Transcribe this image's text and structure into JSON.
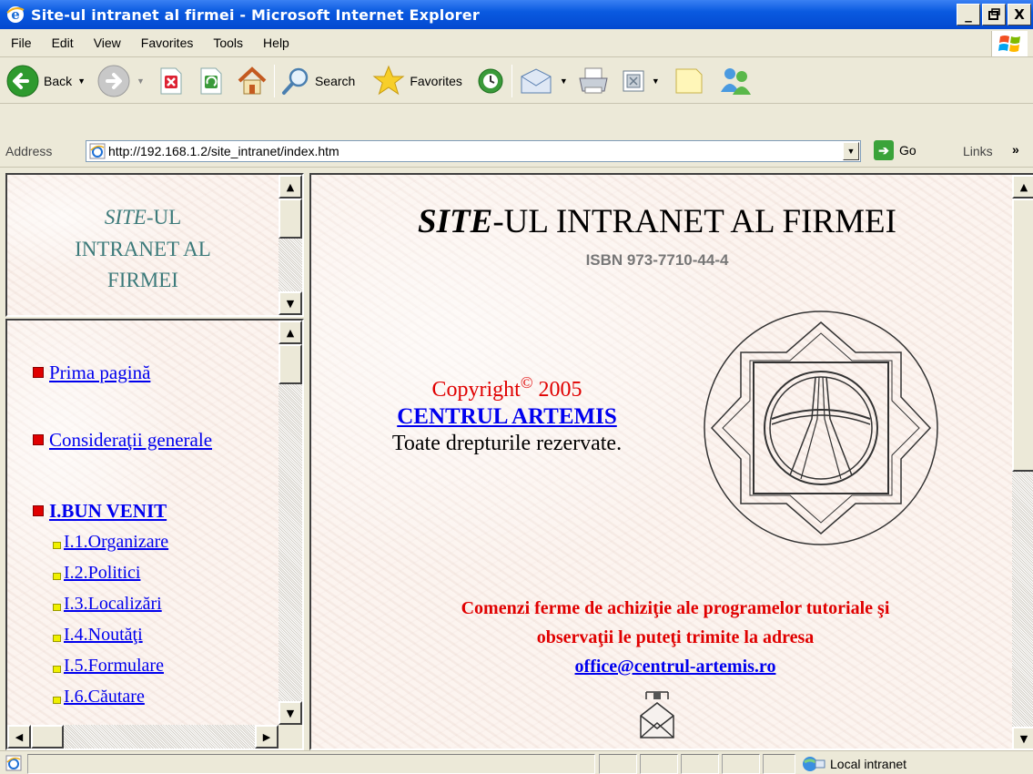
{
  "window": {
    "title": "Site-ul intranet al firmei - Microsoft Internet Explorer",
    "controls": {
      "minimize": "_",
      "maximize": " ",
      "close": "X"
    }
  },
  "menu": [
    "File",
    "Edit",
    "View",
    "Favorites",
    "Tools",
    "Help"
  ],
  "toolbar": {
    "back_label": "Back",
    "search_label": "Search",
    "favorites_label": "Favorites"
  },
  "address": {
    "label": "Address",
    "url": "http://192.168.1.2/site_intranet/index.htm",
    "go_label": "Go",
    "links_label": "Links",
    "links_chevron": "»"
  },
  "left_top_frame": {
    "title_italic": "SITE",
    "title_rest_line1": "-UL",
    "title_line2": "INTRANET AL",
    "title_line3": "FIRMEI"
  },
  "nav": {
    "items": [
      {
        "label": "Prima pagină"
      },
      {
        "label": "Consideraţii generale"
      },
      {
        "label": "I.BUN VENIT"
      }
    ],
    "subitems": [
      {
        "label": "I.1.Organizare"
      },
      {
        "label": "I.2.Politici"
      },
      {
        "label": "I.3.Localizări"
      },
      {
        "label": "I.4.Noutăţi"
      },
      {
        "label": "I.5.Formulare"
      },
      {
        "label": "I.6.Căutare"
      }
    ]
  },
  "main": {
    "title_italic": "SITE",
    "title_rest": "-UL INTRANET AL FIRMEI",
    "isbn": "ISBN 973-7710-44-4",
    "copyright_word": "Copyright",
    "copyright_symbol": "©",
    "copyright_year": "2005",
    "company_link": "CENTRUL ARTEMIS",
    "rights": "Toate drepturile rezervate.",
    "orders_line1": "Comenzi ferme de achiziţie ale programelor tutoriale şi",
    "orders_line2": "observaţii le puteţi trimite la adresa",
    "email": "office@centrul-artemis.ro"
  },
  "status": {
    "zone": "Local intranet"
  },
  "colors": {
    "title_bar": "#0a5ae0",
    "link": "#0000ee",
    "red_text": "#e00000",
    "teal_title": "#3c7a7a",
    "paper": "#fbf1ec"
  },
  "icons": [
    "ie-icon",
    "back-icon",
    "forward-icon",
    "stop-icon",
    "refresh-icon",
    "home-icon",
    "search-icon",
    "favorites-icon",
    "history-icon",
    "mail-icon",
    "print-icon",
    "edit-icon",
    "discuss-icon",
    "messenger-icon",
    "go-icon",
    "windows-logo-icon",
    "envelope-icon",
    "emblem-icon"
  ]
}
